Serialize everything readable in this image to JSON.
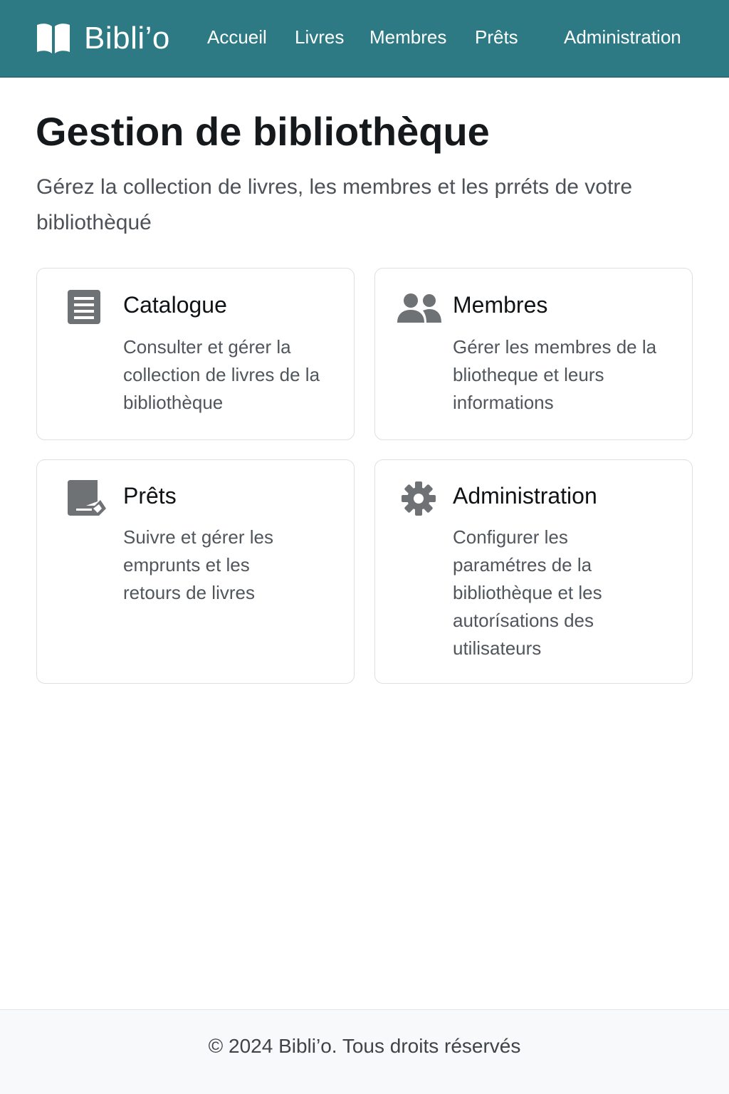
{
  "app": {
    "brand_name": "Bibli’o",
    "brand_icon": "open-book-icon"
  },
  "nav": {
    "items": [
      {
        "label": "Accueil"
      },
      {
        "label": "Livres"
      },
      {
        "label": "Membres"
      },
      {
        "label": "Prêts"
      },
      {
        "label": "Administration"
      }
    ]
  },
  "hero": {
    "title": "Gestion de bibliothèque",
    "subtitle": "Gérez la collection de livres, les membres et les prréts de votre bibliothèqué"
  },
  "cards": [
    {
      "icon": "document-list-icon",
      "title": "Catalogue",
      "description": "Consulter et gérer la collection de livres de la bibliothèque"
    },
    {
      "icon": "people-icon",
      "title": "Membres",
      "description": "Gérer les membres de la bliotheque et leurs informations"
    },
    {
      "icon": "loan-book-icon",
      "title": "Prêts",
      "description": "Suivre et gérer les emprunts et les retours de livres"
    },
    {
      "icon": "gear-icon",
      "title": "Administration",
      "description": "Configurer les paramétres de la bibliothèque et les autorísations des utilisateurs"
    }
  ],
  "footer": {
    "text": "© 2024 Bibli’o. Tous droits réservés"
  },
  "colors": {
    "header_background": "#2e7a84",
    "icon_gray": "#6e7275",
    "footer_background": "#f8f9fa"
  }
}
